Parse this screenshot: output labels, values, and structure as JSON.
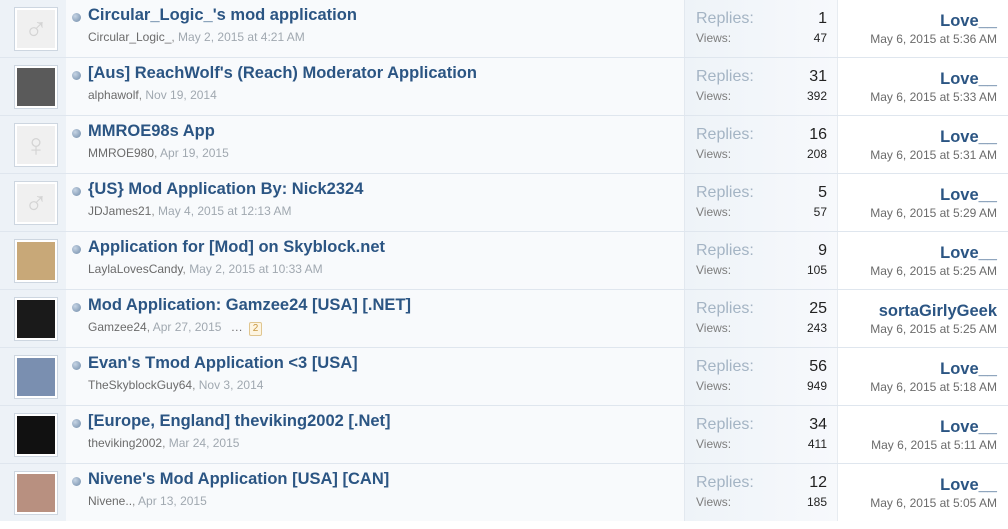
{
  "threads": [
    {
      "title": "Circular_Logic_'s mod application",
      "author": "Circular_Logic_",
      "date": "May 2, 2015 at 4:21 AM",
      "replies": "1",
      "views": "47",
      "last_user": "Love__",
      "last_date": "May 6, 2015 at 5:36 AM",
      "avatar": "male-icon",
      "page": ""
    },
    {
      "title": "[Aus] ReachWolf's (Reach) Moderator Application",
      "author": "alphawolf",
      "date": "Nov 19, 2014",
      "replies": "31",
      "views": "392",
      "last_user": "Love__",
      "last_date": "May 6, 2015 at 5:33 AM",
      "avatar": "photo",
      "page": ""
    },
    {
      "title": "MMROE98s App",
      "author": "MMROE980",
      "date": "Apr 19, 2015",
      "replies": "16",
      "views": "208",
      "last_user": "Love__",
      "last_date": "May 6, 2015 at 5:31 AM",
      "avatar": "female-icon",
      "page": ""
    },
    {
      "title": "{US} Mod Application By: Nick2324",
      "author": "JDJames21",
      "date": "May 4, 2015 at 12:13 AM",
      "replies": "5",
      "views": "57",
      "last_user": "Love__",
      "last_date": "May 6, 2015 at 5:29 AM",
      "avatar": "male-icon",
      "page": ""
    },
    {
      "title": "Application for [Mod] on Skyblock.net",
      "author": "LaylaLovesCandy",
      "date": "May 2, 2015 at 10:33 AM",
      "replies": "9",
      "views": "105",
      "last_user": "Love__",
      "last_date": "May 6, 2015 at 5:25 AM",
      "avatar": "photo",
      "page": ""
    },
    {
      "title": "Mod Application: Gamzee24 [USA] [.NET]",
      "author": "Gamzee24",
      "date": "Apr 27, 2015",
      "replies": "25",
      "views": "243",
      "last_user": "sortaGirlyGeek",
      "last_date": "May 6, 2015 at 5:25 AM",
      "avatar": "photo",
      "page": "2"
    },
    {
      "title": "Evan's Tmod Application <3 [USA]",
      "author": "TheSkyblockGuy64",
      "date": "Nov 3, 2014",
      "replies": "56",
      "views": "949",
      "last_user": "Love__",
      "last_date": "May 6, 2015 at 5:18 AM",
      "avatar": "photo",
      "page": ""
    },
    {
      "title": "[Europe, England] theviking2002 [.Net]",
      "author": "theviking2002",
      "date": "Mar 24, 2015",
      "replies": "34",
      "views": "411",
      "last_user": "Love__",
      "last_date": "May 6, 2015 at 5:11 AM",
      "avatar": "photo",
      "page": ""
    },
    {
      "title": "Nivene's Mod Application [USA] [CAN]",
      "author": "Nivene..",
      "date": "Apr 13, 2015",
      "replies": "12",
      "views": "185",
      "last_user": "Love__",
      "last_date": "May 6, 2015 at 5:05 AM",
      "avatar": "photo",
      "page": ""
    }
  ],
  "labels": {
    "replies": "Replies:",
    "views": "Views:",
    "ellipsis": "…"
  },
  "colors": {
    "title": "#2b5583",
    "photo_bg": [
      "#c7a0c0",
      "#5a5a5a",
      "#d9d9d9",
      "#e0e0e0",
      "#c8a878",
      "#1a1a1a",
      "#7a8fb0",
      "#111111",
      "#b89080"
    ]
  }
}
